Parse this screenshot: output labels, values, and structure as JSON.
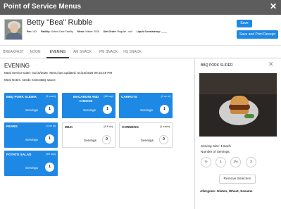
{
  "window": {
    "title": "Point of Service Menus",
    "close_glyph": "✕"
  },
  "resident": {
    "name": "Betty \"Bea\" Rubble",
    "info": [
      {
        "label": "Rm:",
        "value": "103"
      },
      {
        "label": "Facility:",
        "value": "Sched Care Facility"
      },
      {
        "label": "Menu:",
        "value": "Winter 2026"
      },
      {
        "label": "Diet Order:",
        "value": "Regular - null"
      },
      {
        "label": "Liquid Consistency:",
        "value": "____"
      }
    ]
  },
  "buttons": {
    "save": "Save",
    "save_print": "Save and Print Receipt",
    "remove": "Remove Selection"
  },
  "tabs": [
    "BREAKFAST",
    "NOON",
    "EVENING",
    "AM SNACK",
    "PM SNACK",
    "HS SNACK"
  ],
  "active_tab": "EVENING",
  "meal": {
    "title": "EVENING",
    "service_label": "Meal Service Date:",
    "service_date": "01/15/2026",
    "updated_label": "Menu last updated:",
    "updated_date": "01/15/2026 09:15:48 PM",
    "notes_label": "Meal Notes:",
    "notes": "needs extra BBQ sauce"
  },
  "servings_label": "Servings",
  "items": [
    {
      "name": "BBQ PORK SLIDER",
      "portion": "(1 each)",
      "servings": "1",
      "selected": true
    },
    {
      "name": "MACARONI AND CHEESE",
      "portion": "(#8 scp)",
      "servings": "1",
      "selected": true
    },
    {
      "name": "CARROTS",
      "portion": "(4 oz sl)",
      "servings": "1",
      "selected": true
    },
    {
      "name": "PEARS",
      "portion": "(4 oz sl)",
      "servings": "1",
      "selected": true
    },
    {
      "name": "MILK",
      "portion": "(8 fl oz)",
      "servings": "0",
      "selected": false
    },
    {
      "name": "CORNDOG",
      "portion": "(1 each)",
      "servings": "0",
      "selected": false
    },
    {
      "name": "POTATO SALAD",
      "portion": "(#8 scp)",
      "servings": "1",
      "selected": true
    }
  ],
  "detail": {
    "title": "BBQ PORK SLIDER",
    "close_glyph": "✕",
    "serving_size_label": "Serving Size:",
    "serving_size": "1 Each",
    "num_servings_label": "Number of Servings:",
    "choices": [
      "½",
      "1",
      "1½",
      "2"
    ],
    "allergens": "Allergens: Gluten, Wheat, Sesame"
  },
  "colors": {
    "titlebar": "#5d5d5d",
    "accent": "#1e88e5"
  },
  "icons": {
    "close": "close-icon",
    "avatar": "resident-photo"
  }
}
